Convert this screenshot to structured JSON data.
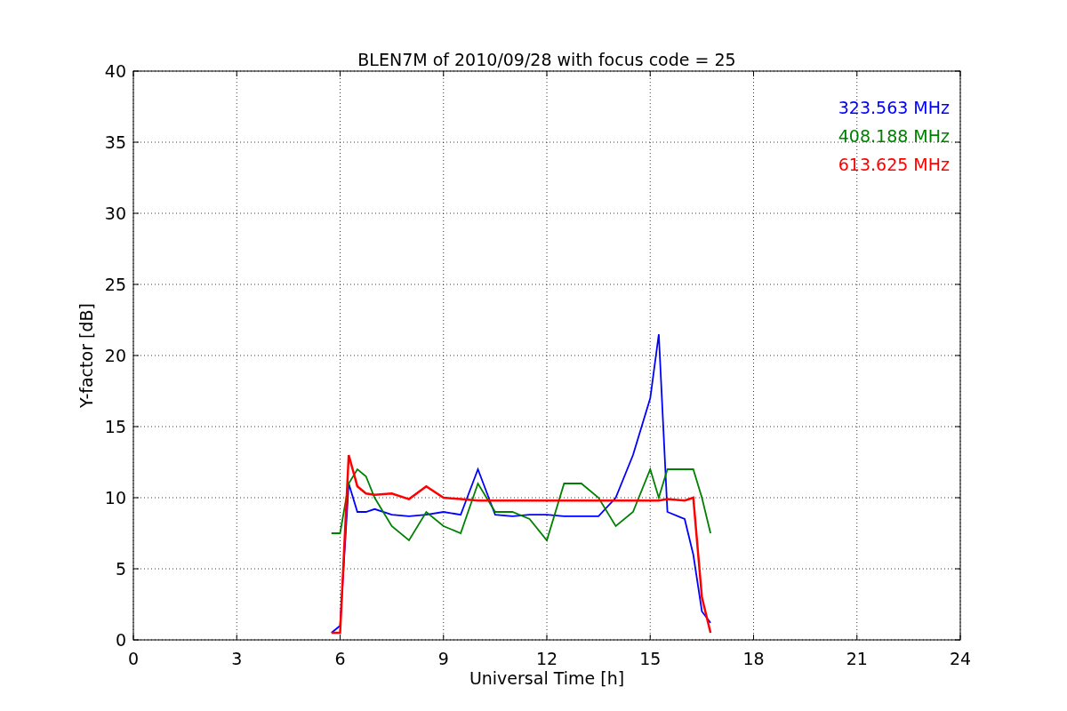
{
  "chart_data": {
    "type": "line",
    "title": "BLEN7M of 2010/09/28 with focus code = 25",
    "xlabel": "Universal Time [h]",
    "ylabel": "Y-factor [dB]",
    "x": [
      5.75,
      6.0,
      6.25,
      6.5,
      6.75,
      7,
      7.5,
      8,
      8.5,
      9,
      9.5,
      10,
      10.5,
      11,
      11.5,
      12,
      12.5,
      13,
      13.5,
      14,
      14.5,
      15,
      15.25,
      15.5,
      16,
      16.25,
      16.5,
      16.75
    ],
    "series": [
      {
        "name": "323.563 MHz",
        "color": "#0000ff",
        "values": [
          0.5,
          1,
          11,
          9,
          9,
          9.2,
          8.8,
          8.7,
          8.8,
          9,
          8.8,
          12,
          8.8,
          8.7,
          8.8,
          8.8,
          8.7,
          8.7,
          8.7,
          10,
          13,
          17,
          21.5,
          9,
          8.5,
          6,
          2,
          1.2
        ]
      },
      {
        "name": "408.188 MHz",
        "color": "#008000",
        "values": [
          7.5,
          7.5,
          11,
          12,
          11.5,
          10,
          8,
          7,
          9,
          8,
          7.5,
          11,
          9,
          9,
          8.5,
          7,
          11,
          11,
          10,
          8,
          9,
          12,
          10,
          12,
          12,
          12,
          10,
          7.5
        ]
      },
      {
        "name": "613.625 MHz",
        "color": "#ff0000",
        "values": [
          0.5,
          0.5,
          13,
          10.8,
          10.3,
          10.2,
          10.3,
          9.9,
          10.8,
          10,
          9.9,
          9.8,
          9.8,
          9.8,
          9.8,
          9.8,
          9.8,
          9.8,
          9.8,
          9.8,
          9.8,
          9.8,
          9.8,
          9.9,
          9.8,
          10,
          3,
          0.5
        ]
      }
    ],
    "grid": true,
    "xlim": [
      0,
      24
    ],
    "ylim": [
      0,
      40
    ],
    "xticks": [
      0,
      3,
      6,
      9,
      12,
      15,
      18,
      21,
      24
    ],
    "yticks": [
      0,
      5,
      10,
      15,
      20,
      25,
      30,
      35,
      40
    ]
  }
}
